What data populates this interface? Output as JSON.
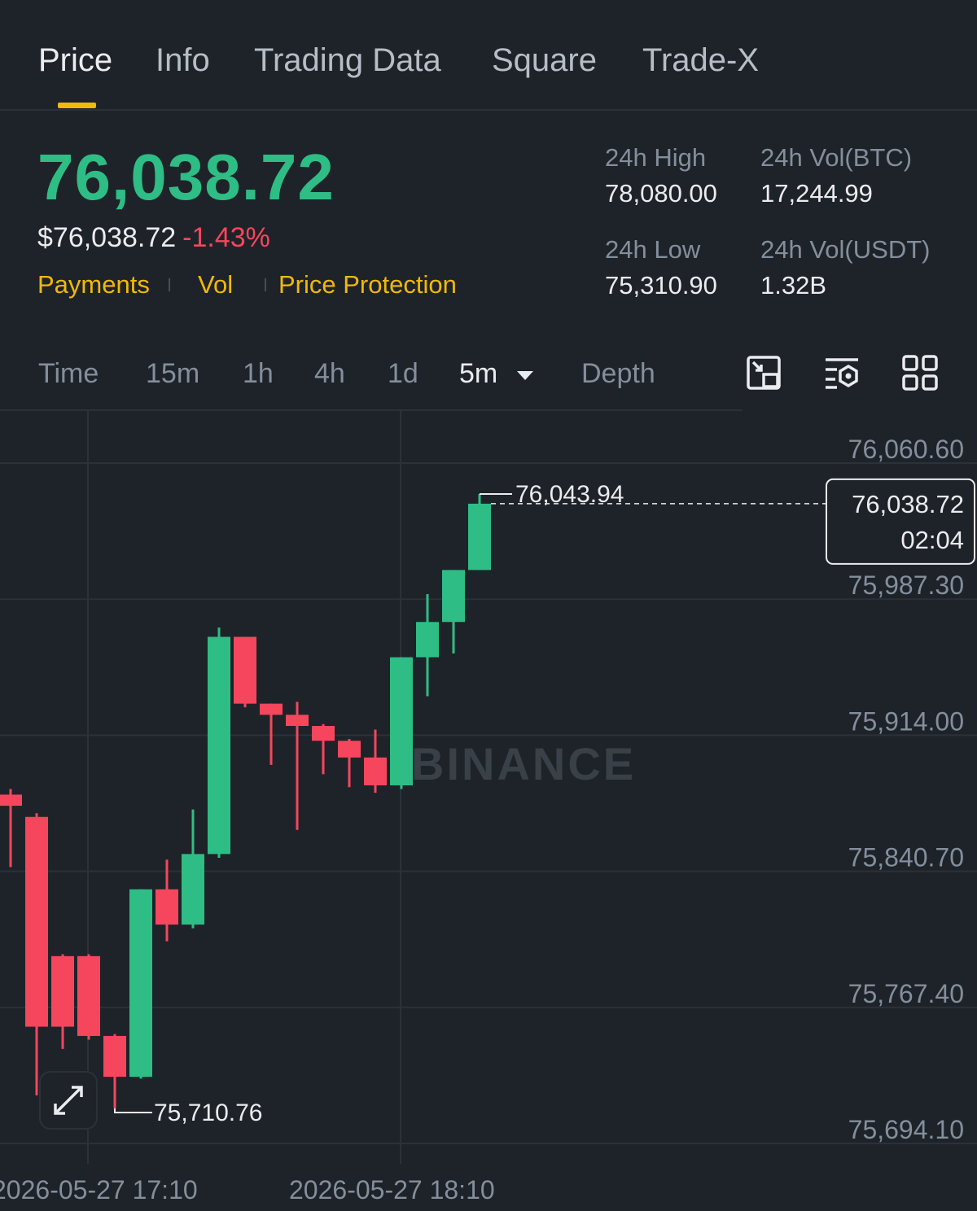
{
  "tabs": [
    {
      "label": "Price",
      "active": true
    },
    {
      "label": "Info",
      "active": false
    },
    {
      "label": "Trading Data",
      "active": false
    },
    {
      "label": "Square",
      "active": false
    },
    {
      "label": "Trade-X",
      "active": false
    }
  ],
  "ticker": {
    "last_price": "76,038.72",
    "usd_price": "$76,038.72",
    "change_pct": "-1.43%",
    "links": [
      "Payments",
      "Vol",
      "Price Protection"
    ],
    "high_24h_label": "24h High",
    "high_24h": "78,080.00",
    "low_24h_label": "24h Low",
    "low_24h": "75,310.90",
    "vol_btc_label": "24h Vol(BTC)",
    "vol_btc": "17,244.99",
    "vol_usdt_label": "24h Vol(USDT)",
    "vol_usdt": "1.32B"
  },
  "intervals": {
    "items": [
      "Time",
      "15m",
      "1h",
      "4h",
      "1d"
    ],
    "selected": "5m",
    "depth": "Depth"
  },
  "toolbar_icons": [
    "chart-switch-icon",
    "indicator-settings-icon",
    "grid-layout-icon"
  ],
  "colors": {
    "up": "#2ebd85",
    "down": "#f6465d",
    "accent": "#f0b90b",
    "background": "#1e2329"
  },
  "chart_data": {
    "type": "candlestick",
    "y_ticks": [
      "76,060.60",
      "75,987.30",
      "75,914.00",
      "75,840.70",
      "75,767.40",
      "75,694.10"
    ],
    "ylim": [
      75694.1,
      76060.6
    ],
    "x_ticks": [
      "2026-05-27 17:10",
      "2026-05-27 18:10"
    ],
    "current_price": "76,038.72",
    "countdown": "02:04",
    "high_marker": "76,043.94",
    "low_marker": "75,710.76",
    "watermark": "BINANCE",
    "candles": [
      {
        "o": 75882.0,
        "h": 75885.0,
        "l": 75843.0,
        "c": 75876.0
      },
      {
        "o": 75870.0,
        "h": 75872.0,
        "l": 75720.0,
        "c": 75757.0
      },
      {
        "o": 75795.0,
        "h": 75796.0,
        "l": 75745.0,
        "c": 75757.0
      },
      {
        "o": 75795.0,
        "h": 75796.0,
        "l": 75750.0,
        "c": 75752.0
      },
      {
        "o": 75752.0,
        "h": 75753.0,
        "l": 75713.0,
        "c": 75730.0
      },
      {
        "o": 75730.0,
        "h": 75831.0,
        "l": 75729.0,
        "c": 75831.0
      },
      {
        "o": 75831.0,
        "h": 75847.0,
        "l": 75803.0,
        "c": 75812.0
      },
      {
        "o": 75812.0,
        "h": 75874.0,
        "l": 75810.0,
        "c": 75850.0
      },
      {
        "o": 75850.0,
        "h": 75972.0,
        "l": 75848.0,
        "c": 75967.0
      },
      {
        "o": 75967.0,
        "h": 75967.0,
        "l": 75929.0,
        "c": 75931.0
      },
      {
        "o": 75931.0,
        "h": 75931.0,
        "l": 75898.0,
        "c": 75925.0
      },
      {
        "o": 75925.0,
        "h": 75932.0,
        "l": 75863.0,
        "c": 75919.0
      },
      {
        "o": 75919.0,
        "h": 75920.0,
        "l": 75893.0,
        "c": 75911.0
      },
      {
        "o": 75911.0,
        "h": 75912.0,
        "l": 75886.0,
        "c": 75902.0
      },
      {
        "o": 75902.0,
        "h": 75917.0,
        "l": 75883.0,
        "c": 75887.0
      },
      {
        "o": 75887.0,
        "h": 75956.0,
        "l": 75885.0,
        "c": 75956.0
      },
      {
        "o": 75956.0,
        "h": 75990.0,
        "l": 75935.0,
        "c": 75975.0
      },
      {
        "o": 75975.0,
        "h": 76003.0,
        "l": 75958.0,
        "c": 76003.0
      },
      {
        "o": 76003.0,
        "h": 76043.94,
        "l": 76003.0,
        "c": 76038.72
      }
    ]
  }
}
